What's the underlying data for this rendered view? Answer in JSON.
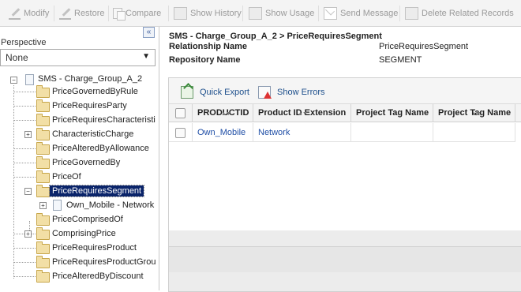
{
  "toolbar": {
    "modify": "Modify",
    "restore": "Restore",
    "compare": "Compare",
    "show_history": "Show History",
    "show_usage": "Show Usage",
    "send_message": "Send Message",
    "delete_related": "Delete Related Records"
  },
  "left_panel": {
    "collapse_glyph": "«",
    "perspective_label": "Perspective",
    "perspective_value": "None",
    "dropdown_arrow": "▼"
  },
  "tree": {
    "root": "SMS - Charge_Group_A_2",
    "nodes": [
      {
        "label": "PriceGovernedByRule"
      },
      {
        "label": "PriceRequiresParty"
      },
      {
        "label": "PriceRequiresCharacteristi"
      },
      {
        "label": "CharacteristicCharge"
      },
      {
        "label": "PriceAlteredByAllowance"
      },
      {
        "label": "PriceGovernedBy"
      },
      {
        "label": "PriceOf"
      },
      {
        "label": "PriceRequiresSegment",
        "selected": true
      },
      {
        "label": "Own_Mobile - Network"
      },
      {
        "label": "PriceComprisedOf"
      },
      {
        "label": "ComprisingPrice"
      },
      {
        "label": "PriceRequiresProduct"
      },
      {
        "label": "PriceRequiresProductGrou"
      },
      {
        "label": "PriceAlteredByDiscount"
      }
    ]
  },
  "detail": {
    "title": "SMS - Charge_Group_A_2 > PriceRequiresSegment",
    "relationship_label": "Relationship Name",
    "relationship_value": "PriceRequiresSegment",
    "repository_label": "Repository Name",
    "repository_value": "SEGMENT"
  },
  "grid": {
    "quick_export": "Quick Export",
    "show_errors": "Show Errors",
    "sort_glyph": "▲▼",
    "columns": [
      "PRODUCTID",
      "Product ID Extension",
      "Project Tag Name",
      "Project Tag Name"
    ],
    "rows": [
      [
        "Own_Mobile",
        "Network",
        "",
        ""
      ]
    ]
  },
  "colors": {
    "selection": "#0a246a",
    "link": "#1f4ea6"
  }
}
